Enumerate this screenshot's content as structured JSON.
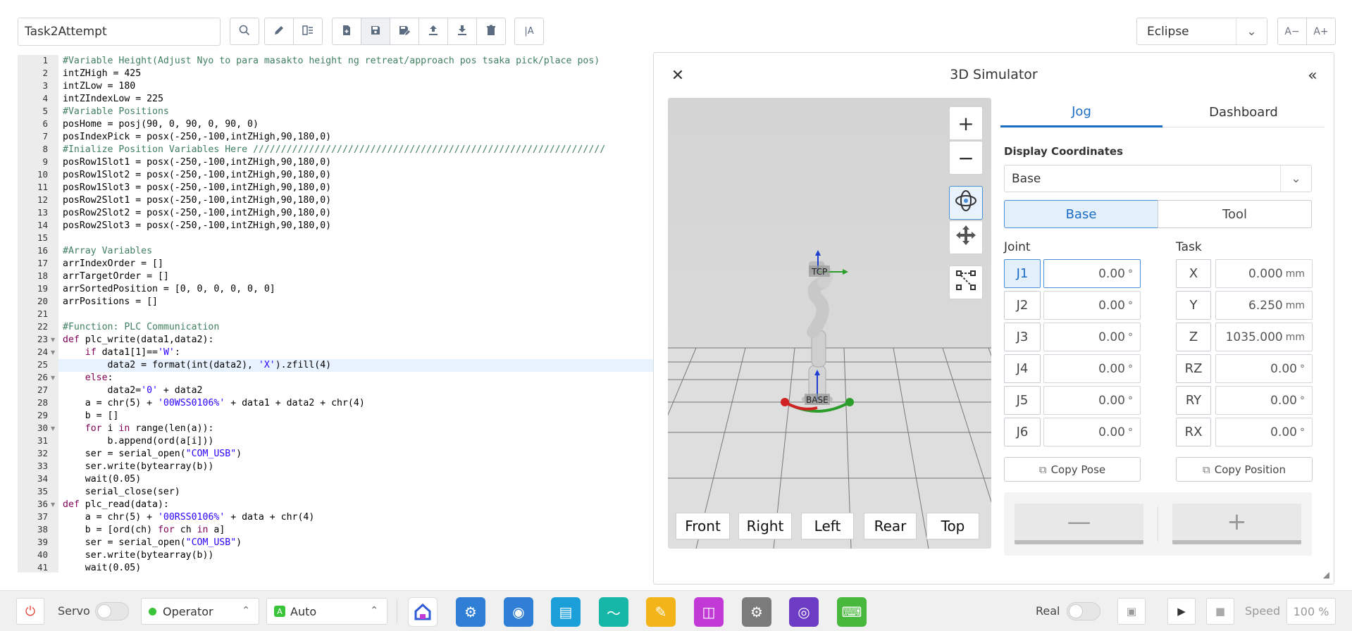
{
  "toolbar": {
    "file_name": "Task2Attempt",
    "theme": "Eclipse",
    "font_decrease": "A−",
    "font_increase": "A+",
    "tools": [
      "search-icon",
      "edit-icon",
      "outline-icon",
      "new-file-icon",
      "save-icon",
      "save-as-icon",
      "upload-icon",
      "download-icon",
      "delete-icon",
      "text-format-icon"
    ]
  },
  "editor": {
    "current_line": 25,
    "lines": [
      {
        "n": "1",
        "t": "#Variable Height(Adjust Nyo to para masakto height ng retreat/approach pos tsaka pick/place pos)",
        "k": "c"
      },
      {
        "n": "2",
        "t": "intZHigh = 425",
        "k": "n"
      },
      {
        "n": "3",
        "t": "intZLow = 180",
        "k": "n"
      },
      {
        "n": "4",
        "t": "intZIndexLow = 225",
        "k": "n"
      },
      {
        "n": "5",
        "t": "#Variable Positions",
        "k": "c"
      },
      {
        "n": "6",
        "t": "posHome = posj(90, 0, 90, 0, 90, 0)",
        "k": "n"
      },
      {
        "n": "7",
        "t": "posIndexPick = posx(-250,-100,intZHigh,90,180,0)",
        "k": "n"
      },
      {
        "n": "8",
        "t": "#Inialize Position Variables Here ///////////////////////////////////////////////////////////////",
        "k": "c"
      },
      {
        "n": "9",
        "t": "posRow1Slot1 = posx(-250,-100,intZHigh,90,180,0)",
        "k": "n"
      },
      {
        "n": "10",
        "t": "posRow1Slot2 = posx(-250,-100,intZHigh,90,180,0)",
        "k": "n"
      },
      {
        "n": "11",
        "t": "posRow1Slot3 = posx(-250,-100,intZHigh,90,180,0)",
        "k": "n"
      },
      {
        "n": "12",
        "t": "posRow2Slot1 = posx(-250,-100,intZHigh,90,180,0)",
        "k": "n"
      },
      {
        "n": "13",
        "t": "posRow2Slot2 = posx(-250,-100,intZHigh,90,180,0)",
        "k": "n"
      },
      {
        "n": "14",
        "t": "posRow2Slot3 = posx(-250,-100,intZHigh,90,180,0)",
        "k": "n"
      },
      {
        "n": "15",
        "t": "",
        "k": "n"
      },
      {
        "n": "16",
        "t": "#Array Variables",
        "k": "c"
      },
      {
        "n": "17",
        "t": "arrIndexOrder = []",
        "k": "n"
      },
      {
        "n": "18",
        "t": "arrTargetOrder = []",
        "k": "n"
      },
      {
        "n": "19",
        "t": "arrSortedPosition = [0, 0, 0, 0, 0, 0]",
        "k": "n"
      },
      {
        "n": "20",
        "t": "arrPositions = []",
        "k": "n"
      },
      {
        "n": "21",
        "t": "",
        "k": "n"
      },
      {
        "n": "22",
        "t": "#Function: PLC Communication",
        "k": "c"
      },
      {
        "n": "23",
        "t": "def plc_write(data1,data2):",
        "k": "d"
      },
      {
        "n": "24",
        "t": "    if data1[1]=='W':",
        "k": "i"
      },
      {
        "n": "25",
        "t": "        data2 = format(int(data2), 'X').zfill(4)",
        "k": "f"
      },
      {
        "n": "26",
        "t": "    else:",
        "k": "e"
      },
      {
        "n": "27",
        "t": "        data2='0' + data2",
        "k": "s1"
      },
      {
        "n": "28",
        "t": "    a = chr(5) + '00WSS0106%' + data1 + data2 + chr(4)",
        "k": "s2"
      },
      {
        "n": "29",
        "t": "    b = []",
        "k": "n"
      },
      {
        "n": "30",
        "t": "    for i in range(len(a)):",
        "k": "fr"
      },
      {
        "n": "31",
        "t": "        b.append(ord(a[i]))",
        "k": "n"
      },
      {
        "n": "32",
        "t": "    ser = serial_open(\"COM_USB\")",
        "k": "s3"
      },
      {
        "n": "33",
        "t": "    ser.write(bytearray(b))",
        "k": "n"
      },
      {
        "n": "34",
        "t": "    wait(0.05)",
        "k": "n"
      },
      {
        "n": "35",
        "t": "    serial_close(ser)",
        "k": "n"
      },
      {
        "n": "36",
        "t": "def plc_read(data):",
        "k": "d"
      },
      {
        "n": "37",
        "t": "    a = chr(5) + '00RSS0106%' + data + chr(4)",
        "k": "s4"
      },
      {
        "n": "38",
        "t": "    b = [ord(ch) for ch in a]",
        "k": "fr2"
      },
      {
        "n": "39",
        "t": "    ser = serial_open(\"COM_USB\")",
        "k": "s3"
      },
      {
        "n": "40",
        "t": "    ser.write(bytearray(b))",
        "k": "n"
      },
      {
        "n": "41",
        "t": "    wait(0.05)",
        "k": "n"
      }
    ],
    "folds": [
      "23",
      "24",
      "26",
      "30",
      "36"
    ]
  },
  "simulator": {
    "title": "3D Simulator",
    "close_icon": "close-icon",
    "collapse_icon": "double-chevron-icon",
    "zoom_in": "+",
    "zoom_out": "−",
    "view_buttons": [
      "Front",
      "Right",
      "Left",
      "Rear",
      "Top"
    ],
    "scene_labels": {
      "tcp": "TCP",
      "base": "BASE"
    },
    "tabs": [
      "Jog",
      "Dashboard"
    ],
    "active_tab": "Jog",
    "display_coordinates_label": "Display Coordinates",
    "display_coordinates_value": "Base",
    "frame_buttons": [
      "Base",
      "Tool"
    ],
    "active_frame": "Base",
    "joint_label": "Joint",
    "task_label": "Task",
    "joints": [
      {
        "name": "J1",
        "value": "0.00",
        "unit": "°"
      },
      {
        "name": "J2",
        "value": "0.00",
        "unit": "°"
      },
      {
        "name": "J3",
        "value": "0.00",
        "unit": "°"
      },
      {
        "name": "J4",
        "value": "0.00",
        "unit": "°"
      },
      {
        "name": "J5",
        "value": "0.00",
        "unit": "°"
      },
      {
        "name": "J6",
        "value": "0.00",
        "unit": "°"
      }
    ],
    "task": [
      {
        "name": "X",
        "value": "0.000",
        "unit": "mm"
      },
      {
        "name": "Y",
        "value": "6.250",
        "unit": "mm"
      },
      {
        "name": "Z",
        "value": "1035.000",
        "unit": "mm"
      },
      {
        "name": "RZ",
        "value": "0.00",
        "unit": "°"
      },
      {
        "name": "RY",
        "value": "0.00",
        "unit": "°"
      },
      {
        "name": "RX",
        "value": "0.00",
        "unit": "°"
      }
    ],
    "copy_pose": "Copy Pose",
    "copy_position": "Copy Position",
    "jog_minus": "—",
    "jog_plus": "+"
  },
  "statusbar": {
    "servo_label": "Servo",
    "mode_label": "Operator",
    "auto_label": "Auto",
    "real_label": "Real",
    "speed_label": "Speed",
    "speed_value": "100 %",
    "apps": [
      {
        "name": "home-app-icon",
        "color": "#ffffff"
      },
      {
        "name": "robot-app-icon",
        "color": "#2f7fd6"
      },
      {
        "name": "wireless-app-icon",
        "color": "#2f7fd6"
      },
      {
        "name": "document-app-icon",
        "color": "#1a9fd8"
      },
      {
        "name": "monitor-app-icon",
        "color": "#17b7a8"
      },
      {
        "name": "message-app-icon",
        "color": "#f2b418"
      },
      {
        "name": "store-app-icon",
        "color": "#c13ad6"
      },
      {
        "name": "settings-app-icon",
        "color": "#7b7b7b"
      },
      {
        "name": "target-app-icon",
        "color": "#6d3cc4"
      },
      {
        "name": "code-app-icon",
        "color": "#47b83c"
      }
    ]
  }
}
